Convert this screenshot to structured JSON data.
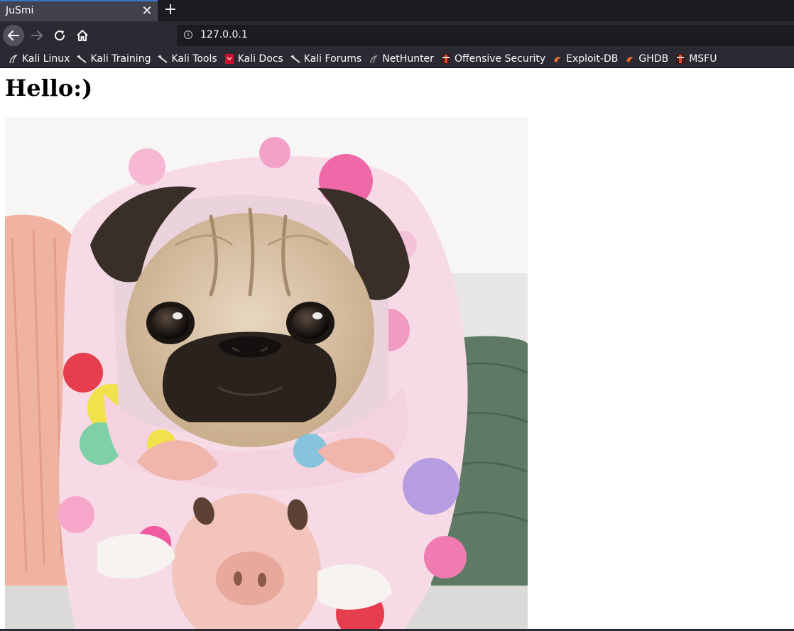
{
  "tab": {
    "title": "JuSmi",
    "close_glyph": "✕",
    "new_tab_glyph": "+"
  },
  "navigation": {
    "back_icon": "back-arrow-icon",
    "forward_icon": "forward-arrow-icon",
    "reload_icon": "reload-icon",
    "home_icon": "home-icon",
    "url": "127.0.0.1",
    "info_glyph": "i"
  },
  "bookmarks": [
    {
      "label": "Kali Linux",
      "icon": "kali-dragon-icon"
    },
    {
      "label": "Kali Training",
      "icon": "kali-dragon-icon"
    },
    {
      "label": "Kali Tools",
      "icon": "kali-dragon-icon"
    },
    {
      "label": "Kali Docs",
      "icon": "kali-docs-icon"
    },
    {
      "label": "Kali Forums",
      "icon": "kali-dragon-icon"
    },
    {
      "label": "NetHunter",
      "icon": "nethunter-icon"
    },
    {
      "label": "Offensive Security",
      "icon": "offsec-icon"
    },
    {
      "label": "Exploit-DB",
      "icon": "exploit-db-icon"
    },
    {
      "label": "GHDB",
      "icon": "ghdb-icon"
    },
    {
      "label": "MSFU",
      "icon": "msfu-icon"
    }
  ],
  "page": {
    "heading": "Hello:)"
  },
  "colors": {
    "tabbar_bg": "#1c1b22",
    "toolbar_bg": "#2b2a33",
    "active_tab_bg": "#42414d",
    "page_bg": "#ffffff"
  }
}
